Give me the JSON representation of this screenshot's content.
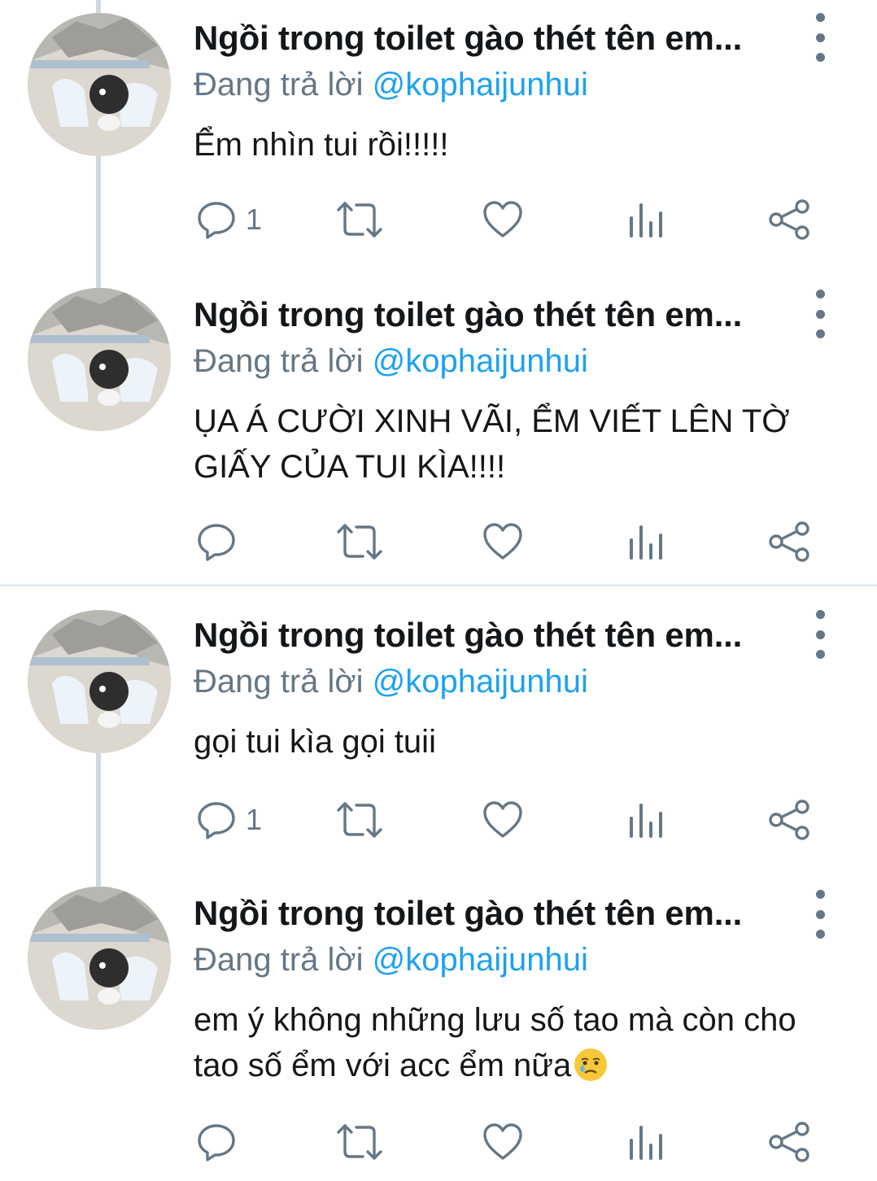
{
  "tweets": [
    {
      "name": "Ngồi trong toilet gào thét tên em...",
      "reply_prefix": "Đang trả lời",
      "reply_handle": "@kophaijunhui",
      "text": "Ểm nhìn tui rồi!!!!!",
      "reply_count": "1"
    },
    {
      "name": "Ngồi trong toilet gào thét tên em...",
      "reply_prefix": "Đang trả lời",
      "reply_handle": "@kophaijunhui",
      "text": "ỤA Á CƯỜI XINH VÃI, ỂM VIẾT LÊN TỜ GIẤY CỦA TUI KÌA!!!!",
      "reply_count": ""
    },
    {
      "name": "Ngồi trong toilet gào thét tên em...",
      "reply_prefix": "Đang trả lời",
      "reply_handle": "@kophaijunhui",
      "text": "gọi tui kìa gọi tuii",
      "reply_count": "1"
    },
    {
      "name": "Ngồi trong toilet gào thét tên em...",
      "reply_prefix": "Đang trả lời",
      "reply_handle": "@kophaijunhui",
      "text": "em ý không những lưu số tao mà còn cho tao số ểm với acc ểm nữa",
      "text_emoji": "crying-face",
      "reply_count": ""
    }
  ],
  "icons": {
    "reply": "reply-bubble-icon",
    "retweet": "retweet-icon",
    "like": "heart-icon",
    "analytics": "bar-chart-icon",
    "share": "share-icon",
    "more": "kebab-menu-icon"
  },
  "colors": {
    "name": "#14171a",
    "secondary": "#657786",
    "handle": "#1da1f2",
    "thread_line": "#cfd9de",
    "divider": "#e6ecf0"
  }
}
